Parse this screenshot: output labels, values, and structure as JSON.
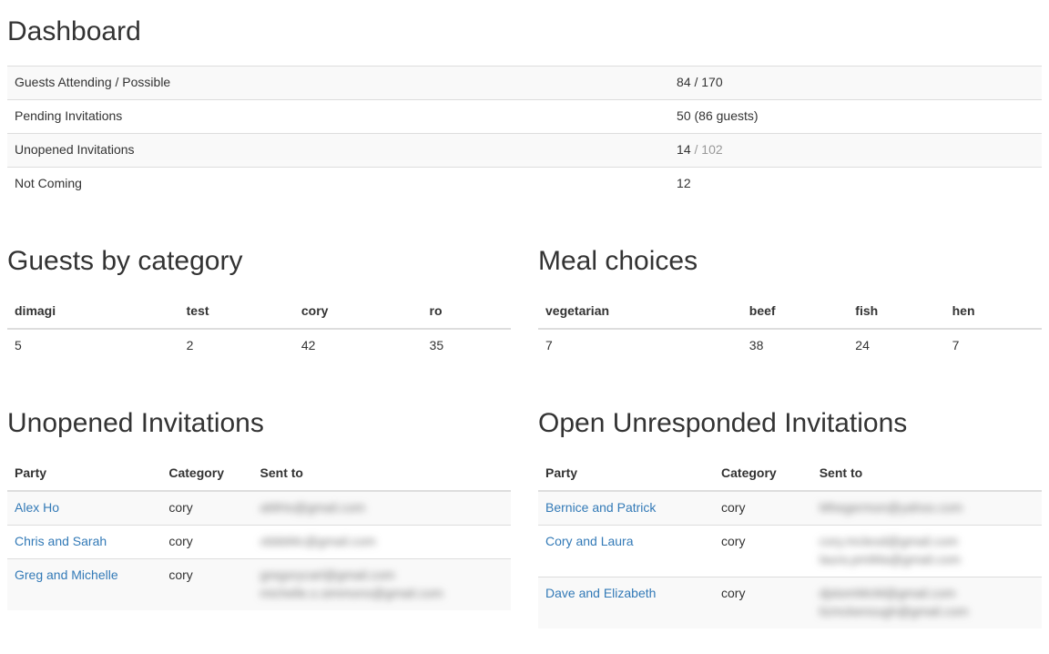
{
  "headings": {
    "dashboard": "Dashboard",
    "guests_by_category": "Guests by category",
    "meal_choices": "Meal choices",
    "unopened": "Unopened Invitations",
    "open_unresponded": "Open Unresponded Invitations"
  },
  "dashboard": {
    "rows": [
      {
        "label": "Guests Attending / Possible",
        "value": "84 / 170"
      },
      {
        "label": "Pending Invitations",
        "value": "50 (86 guests)"
      },
      {
        "label": "Unopened Invitations",
        "value": "14",
        "value_muted": " / 102"
      },
      {
        "label": "Not Coming",
        "value": "12"
      }
    ]
  },
  "categories": {
    "headers": [
      "dimagi",
      "test",
      "cory",
      "ro"
    ],
    "values": [
      "5",
      "2",
      "42",
      "35"
    ]
  },
  "meals": {
    "headers": [
      "vegetarian",
      "beef",
      "fish",
      "hen"
    ],
    "values": [
      "7",
      "38",
      "24",
      "7"
    ]
  },
  "invitations_headers": {
    "party": "Party",
    "category": "Category",
    "sent_to": "Sent to"
  },
  "unopened": [
    {
      "party": "Alex Ho",
      "category": "cory",
      "emails": [
        "aMHo@gmail.com"
      ]
    },
    {
      "party": "Chris and Sarah",
      "category": "cory",
      "emails": [
        "xbbbMc@gmail.com"
      ]
    },
    {
      "party": "Greg and Michelle",
      "category": "cory",
      "emails": [
        "gregorycarl@gmail.com",
        "michelle.o.simmons@gmail.com"
      ]
    }
  ],
  "unresponded": [
    {
      "party": "Bernice and Patrick",
      "category": "cory",
      "emails": [
        "Mhegermon@yahoo.com"
      ]
    },
    {
      "party": "Cory and Laura",
      "category": "cory",
      "emails": [
        "cory.mcleod@gmail.com",
        "laura.pmiMa@gmail.com"
      ]
    },
    {
      "party": "Dave and Elizabeth",
      "category": "cory",
      "emails": [
        "djstomMcM@gmail.com",
        "lizmckenough@gmail.com"
      ]
    }
  ]
}
